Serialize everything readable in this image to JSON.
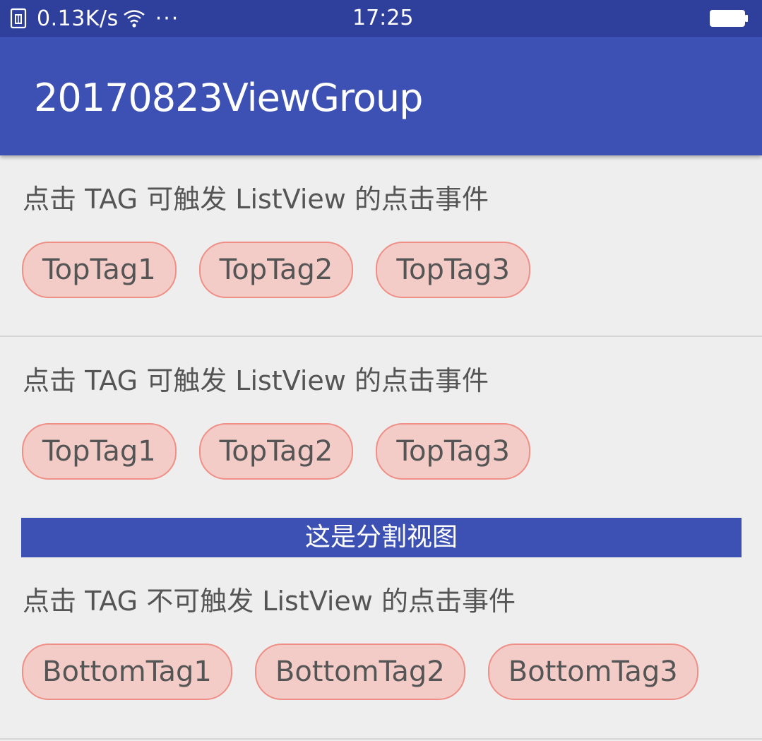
{
  "status_bar": {
    "speed": "0.13K/s",
    "more": "···",
    "time": "17:25",
    "icons": [
      "sim-icon",
      "wifi-icon",
      "battery-icon"
    ]
  },
  "app_bar": {
    "title": "20170823ViewGroup"
  },
  "list": {
    "item1": {
      "label": "点击 TAG 可触发 ListView 的点击事件",
      "tags": [
        "TopTag1",
        "TopTag2",
        "TopTag3"
      ]
    },
    "item2": {
      "label": "点击 TAG 可触发 ListView 的点击事件",
      "tags": [
        "TopTag1",
        "TopTag2",
        "TopTag3"
      ]
    },
    "separator": {
      "label": "这是分割视图"
    },
    "item3": {
      "label": "点击 TAG 不可触发 ListView 的点击事件",
      "tags": [
        "BottomTag1",
        "BottomTag2",
        "BottomTag3"
      ]
    }
  },
  "colors": {
    "status_bar": "#2f3f9c",
    "primary": "#3d50b4",
    "background": "#eeeeee",
    "tag_fill": "#f3ccc8",
    "tag_border": "#ef8f86",
    "text": "#555555"
  }
}
